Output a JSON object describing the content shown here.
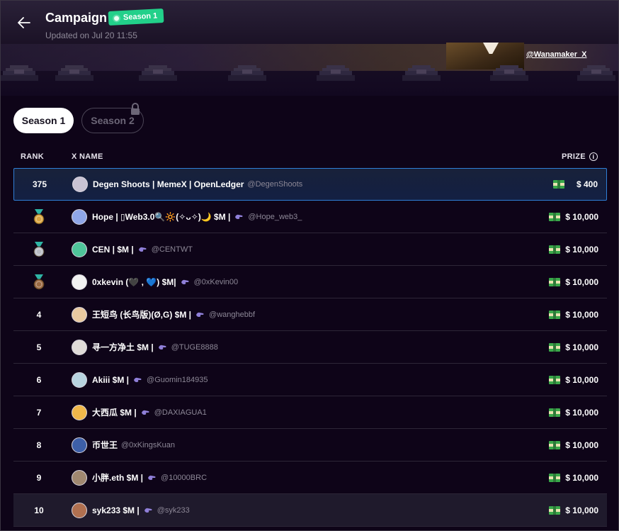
{
  "header": {
    "title": "Campaign",
    "badge": "Season 1",
    "updated": "Updated on Jul 20 11:55",
    "banner_handle": "@Wanamaker_X"
  },
  "tabs": [
    {
      "label": "Season 1",
      "active": true,
      "locked": false
    },
    {
      "label": "Season 2",
      "active": false,
      "locked": true
    }
  ],
  "table": {
    "headers": {
      "rank": "RANK",
      "name": "X NAME",
      "prize": "PRIZE"
    },
    "rows": [
      {
        "rank": "375",
        "medal": "",
        "name": "Degen Shoots | MemeX | OpenLedger",
        "handle": "@DegenShoots",
        "prize": "$ 400",
        "highlight": true,
        "hand": false,
        "avatar_color": "#c9c3d3"
      },
      {
        "rank": "",
        "medal": "gold",
        "name": "Hope | ▯Web3.0🔍🔆(✧ᴗ✧)🌙 $M |",
        "handle": "@Hope_web3_",
        "prize": "$ 10,000",
        "highlight": false,
        "hand": true,
        "avatar_color": "#8fa6e8"
      },
      {
        "rank": "",
        "medal": "silver",
        "name": "CEN | $M |",
        "handle": "@CENTWT",
        "prize": "$ 10,000",
        "highlight": false,
        "hand": true,
        "avatar_color": "#4fc59a"
      },
      {
        "rank": "",
        "medal": "bronze",
        "name": "0xkevin (🖤 , 💙) $M|",
        "handle": "@0xKevin00",
        "prize": "$ 10,000",
        "highlight": false,
        "hand": true,
        "avatar_color": "#f2f2f2"
      },
      {
        "rank": "4",
        "medal": "",
        "name": "王短鸟 (长鸟版)(Ø,G) $M |",
        "handle": "@wanghebbf",
        "prize": "$ 10,000",
        "highlight": false,
        "hand": true,
        "avatar_color": "#e8c9a0"
      },
      {
        "rank": "5",
        "medal": "",
        "name": "寻一方净土 $M |",
        "handle": "@TUGE8888",
        "prize": "$ 10,000",
        "highlight": false,
        "hand": true,
        "avatar_color": "#e0dcd8"
      },
      {
        "rank": "6",
        "medal": "",
        "name": "Akiii $M |",
        "handle": "@Guomin184935",
        "prize": "$ 10,000",
        "highlight": false,
        "hand": true,
        "avatar_color": "#b8d4e0"
      },
      {
        "rank": "7",
        "medal": "",
        "name": "大西瓜 $M |",
        "handle": "@DAXIAGUA1",
        "prize": "$ 10,000",
        "highlight": false,
        "hand": true,
        "avatar_color": "#f0b84a"
      },
      {
        "rank": "8",
        "medal": "",
        "name": "币世王",
        "handle": "@0xKingsKuan",
        "prize": "$ 10,000",
        "highlight": false,
        "hand": false,
        "avatar_color": "#3d5fa8"
      },
      {
        "rank": "9",
        "medal": "",
        "name": "小胖.eth $M |",
        "handle": "@10000BRC",
        "prize": "$ 10,000",
        "highlight": false,
        "hand": true,
        "avatar_color": "#a08870"
      },
      {
        "rank": "10",
        "medal": "",
        "name": "syk233 $M |",
        "handle": "@syk233",
        "prize": "$ 10,000",
        "highlight": false,
        "hand": true,
        "avatar_color": "#b07050",
        "alt": true
      }
    ]
  },
  "colors": {
    "background": "#0e0418",
    "badge_green": "#22d08a",
    "highlight_border": "#2f7fd6",
    "gold": "#d9a441",
    "silver": "#b9bcc4",
    "bronze": "#9a6a43",
    "money": "#3aa84a"
  },
  "icons": [
    "back-arrow-icon",
    "lock-icon",
    "info-icon",
    "medal-icon",
    "hand-icon",
    "money-icon"
  ]
}
